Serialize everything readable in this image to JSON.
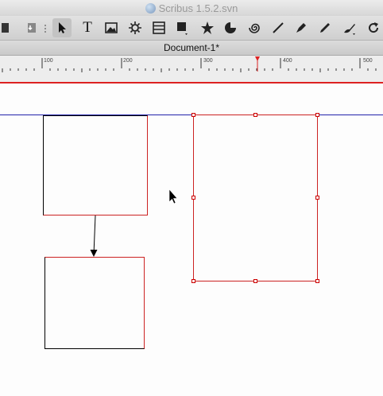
{
  "window": {
    "title": "Scribus 1.5.2.svn"
  },
  "document_tab": {
    "label": "Document-1*"
  },
  "ruler": {
    "labels": [
      "100",
      "200",
      "300",
      "400",
      "500"
    ]
  },
  "toolbar": {
    "tools": [
      "copy-icon",
      "paste-icon",
      "select-icon",
      "text-frame-icon",
      "image-frame-icon",
      "render-frame-icon",
      "table-icon",
      "shape-icon",
      "polygon-icon",
      "arc-icon",
      "spiral-icon",
      "line-icon",
      "bezier-icon",
      "freehand-icon",
      "calligraphic-icon",
      "rotate-icon"
    ],
    "text_tool_glyph": "T"
  },
  "colors": {
    "selection": "#cc2222",
    "guide": "#2222aa",
    "arrow": "#000000"
  }
}
